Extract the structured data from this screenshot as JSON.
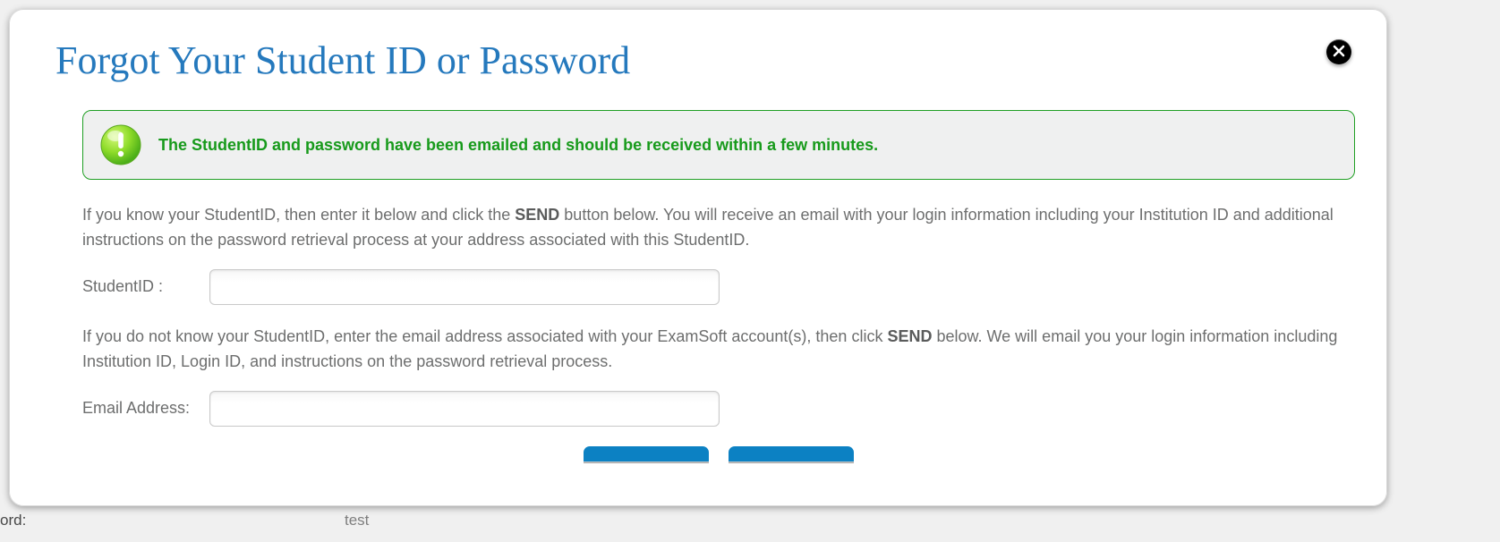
{
  "modal": {
    "title": "Forgot Your Student ID or Password",
    "alert": {
      "message": "The StudentID and password have been emailed and should be received within a few minutes."
    },
    "paragraph1_pre": "If you know your StudentID, then enter it below and click the ",
    "paragraph1_strong": "SEND",
    "paragraph1_post": " button below. You will receive an email with your login information including your Institution ID and additional instructions on the password retrieval process at your address associated with this StudentID.",
    "studentIdLabel": "StudentID :",
    "studentIdValue": "",
    "paragraph2_pre": "If you do not know your StudentID, enter the email address associated with your ExamSoft account(s), then click ",
    "paragraph2_strong": "SEND",
    "paragraph2_post": " below. We will email you your login information including Institution ID, Login ID, and instructions on the password retrieval process.",
    "emailLabel": "Email Address:",
    "emailValue": ""
  },
  "backdrop": {
    "left": "ord:",
    "mid": "test"
  }
}
